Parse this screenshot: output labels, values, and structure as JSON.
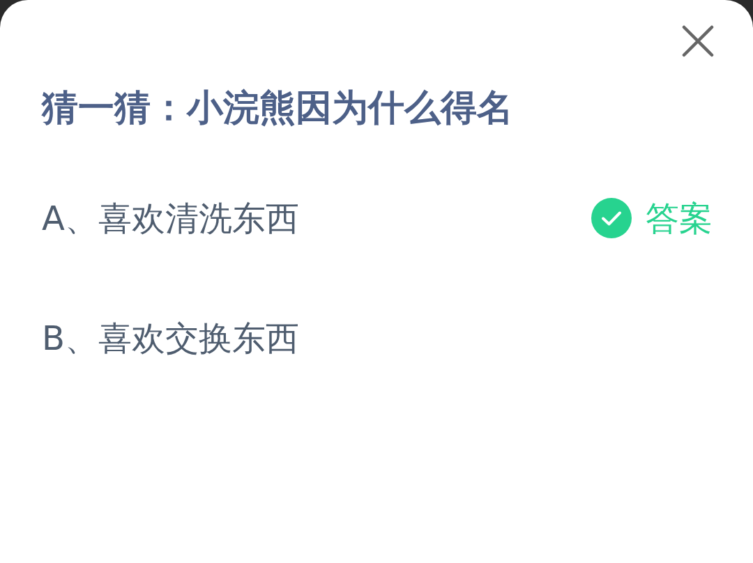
{
  "dialog": {
    "title": "猜一猜：小浣熊因为什么得名",
    "answer_label": "答案",
    "options": [
      {
        "label": "A、喜欢清洗东西",
        "is_answer": true
      },
      {
        "label": "B、喜欢交换东西",
        "is_answer": false
      }
    ]
  }
}
